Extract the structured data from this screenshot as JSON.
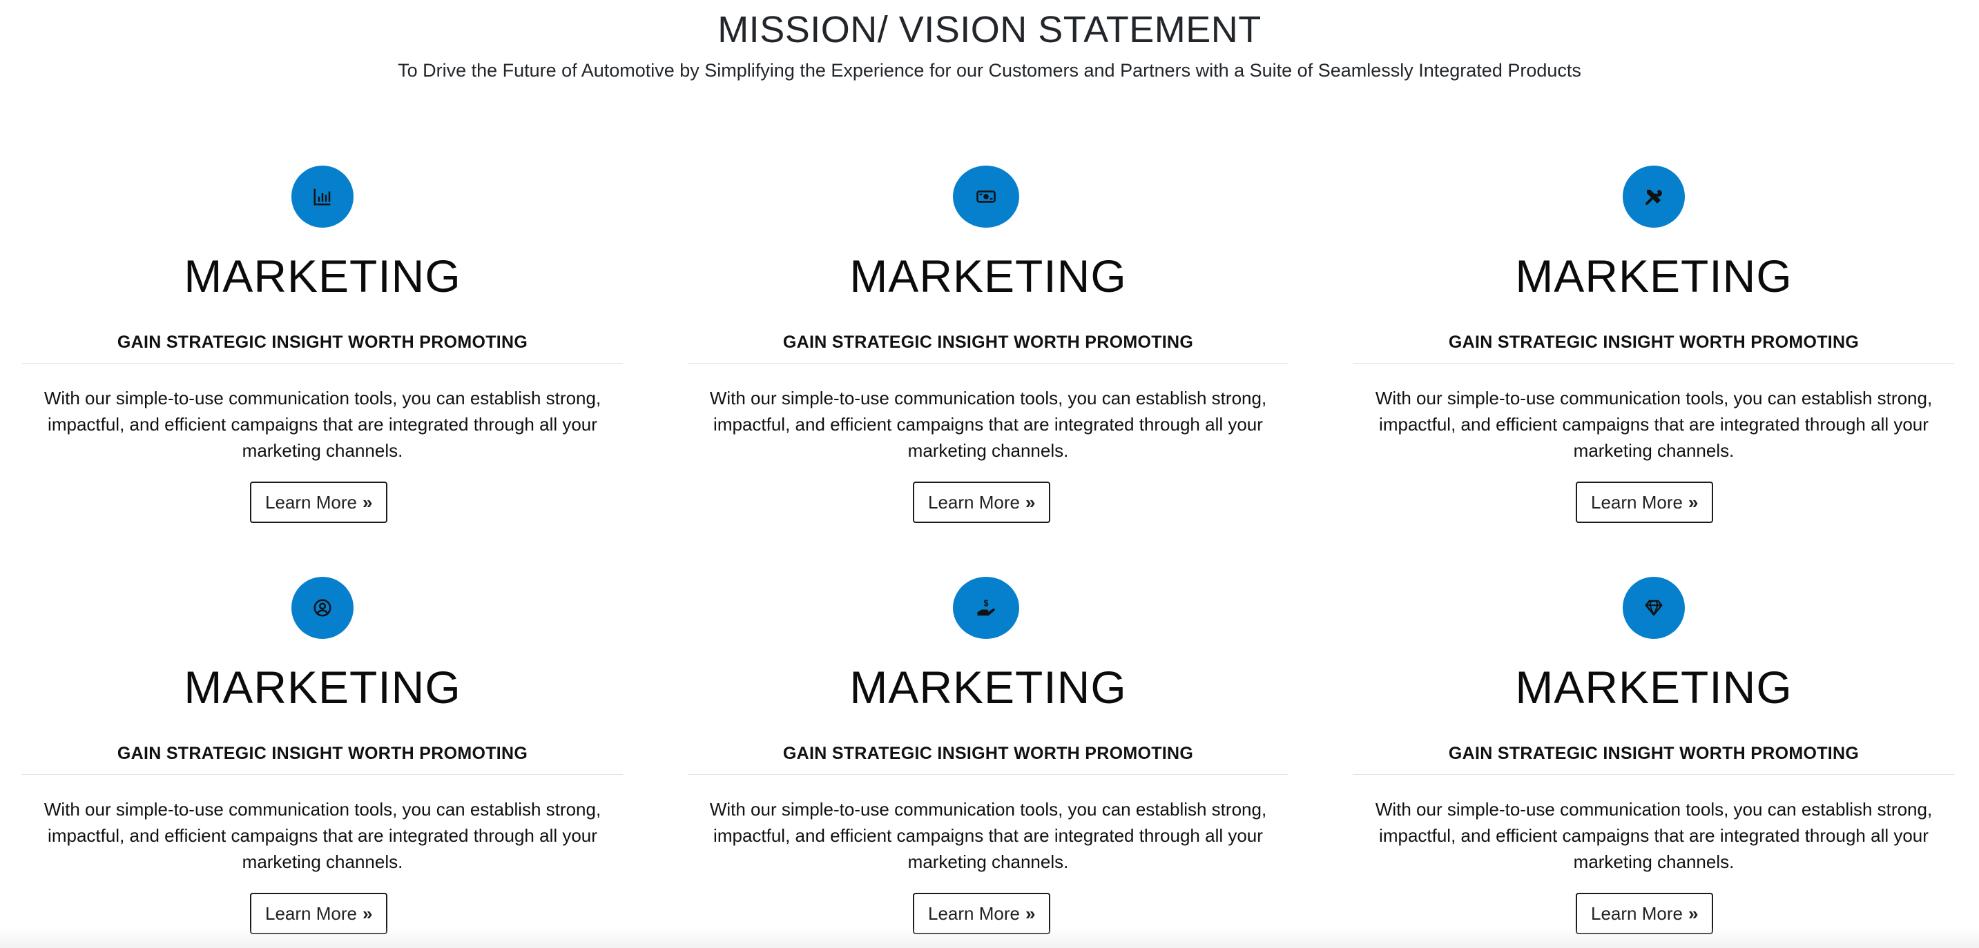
{
  "header": {
    "title": "MISSION/ VISION STATEMENT",
    "subtitle": "To Drive the Future of Automotive by Simplifying the Experience for our Customers and Partners with a Suite of Seamlessly Integrated Products"
  },
  "theme": {
    "accent": "#0680cd"
  },
  "cards": [
    {
      "icon": "bar-chart-icon",
      "heading": "MARKETING",
      "subheading": "GAIN STRATEGIC INSIGHT WORTH PROMOTING",
      "body": "With our simple-to-use communication tools, you can establish strong, impactful, and efficient campaigns that are integrated through all your marketing channels.",
      "button_label": "Learn More",
      "button_icon": "double-chevron-right-icon"
    },
    {
      "icon": "money-bill-icon",
      "heading": "MARKETING",
      "subheading": "GAIN STRATEGIC INSIGHT WORTH PROMOTING",
      "body": "With our simple-to-use communication tools, you can establish strong, impactful, and efficient campaigns that are integrated through all your marketing channels.",
      "button_label": "Learn More",
      "button_icon": "double-chevron-right-icon"
    },
    {
      "icon": "tools-icon",
      "heading": "MARKETING",
      "subheading": "GAIN STRATEGIC INSIGHT WORTH PROMOTING",
      "body": "With our simple-to-use communication tools, you can establish strong, impactful, and efficient campaigns that are integrated through all your marketing channels.",
      "button_label": "Learn More",
      "button_icon": "double-chevron-right-icon"
    },
    {
      "icon": "user-circle-icon",
      "heading": "MARKETING",
      "subheading": "GAIN STRATEGIC INSIGHT WORTH PROMOTING",
      "body": "With our simple-to-use communication tools, you can establish strong, impactful, and efficient campaigns that are integrated through all your marketing channels.",
      "button_label": "Learn More",
      "button_icon": "double-chevron-right-icon"
    },
    {
      "icon": "hand-holding-dollar-icon",
      "heading": "MARKETING",
      "subheading": "GAIN STRATEGIC INSIGHT WORTH PROMOTING",
      "body": "With our simple-to-use communication tools, you can establish strong, impactful, and efficient campaigns that are integrated through all your marketing channels.",
      "button_label": "Learn More",
      "button_icon": "double-chevron-right-icon"
    },
    {
      "icon": "diamond-icon",
      "heading": "MARKETING",
      "subheading": "GAIN STRATEGIC INSIGHT WORTH PROMOTING",
      "body": "With our simple-to-use communication tools, you can establish strong, impactful, and efficient campaigns that are integrated through all your marketing channels.",
      "button_label": "Learn More",
      "button_icon": "double-chevron-right-icon"
    }
  ]
}
